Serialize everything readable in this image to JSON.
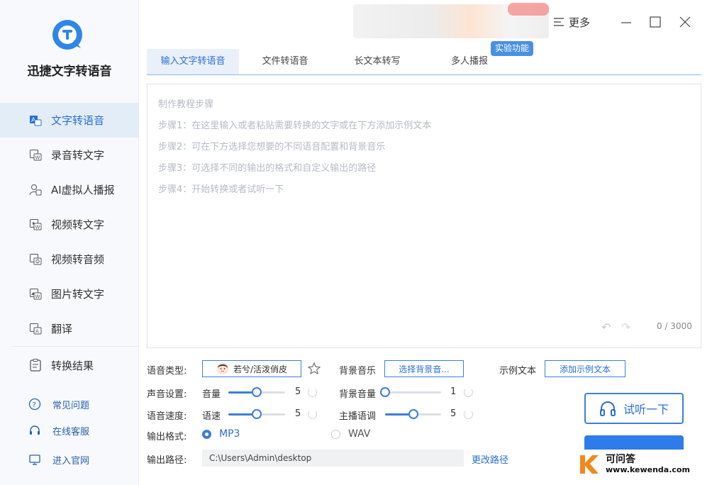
{
  "app": {
    "name": "迅捷文字转语音"
  },
  "header": {
    "more_label": "更多"
  },
  "sidebar": {
    "items": [
      {
        "label": "文字转语音",
        "icon": "text-to-speech-icon"
      },
      {
        "label": "录音转文字",
        "icon": "recording-to-text-icon"
      },
      {
        "label": "AI虚拟人播报",
        "icon": "virtual-person-icon"
      },
      {
        "label": "视频转文字",
        "icon": "video-to-text-icon"
      },
      {
        "label": "视频转音频",
        "icon": "video-to-audio-icon"
      },
      {
        "label": "图片转文字",
        "icon": "image-to-text-icon"
      },
      {
        "label": "翻译",
        "icon": "translate-icon"
      }
    ],
    "result_label": "转换结果",
    "faq_label": "常见问题",
    "service_label": "在线客服",
    "website_label": "进入官网"
  },
  "tabs": [
    "输入文字转语音",
    "文件转语音",
    "长文本转写",
    "多人播报"
  ],
  "experimental_badge": "实验功能",
  "editor": {
    "heading": "制作教程步骤",
    "steps": [
      "步骤1：在这里输入或者粘贴需要转换的文字或在下方添加示例文本",
      "步骤2：可在下方选择您想要的不同语音配置和背景音乐",
      "步骤3：可选择不同的输出的格式和自定义输出的路径",
      "步骤4：开始转换或者试听一下"
    ],
    "char_count": "0 / 3000"
  },
  "settings": {
    "voice_type_label": "语音类型:",
    "voice_name": "若兮/活泼俏皮",
    "bg_music_label": "背景音乐",
    "bg_music_button": "选择背景音...",
    "sample_text_label": "示例文本",
    "sample_text_button": "添加示例文本",
    "sound_settings_label": "声音设置:",
    "volume_label": "音量",
    "volume_value": "5",
    "volume_level": 0.5,
    "bg_volume_label": "背景音量",
    "bg_volume_value": "1",
    "bg_volume_level": 0.0,
    "speed_section_label": "语音速度:",
    "speed_label": "语速",
    "speed_value": "5",
    "speed_level": 0.5,
    "pitch_label": "主播语调",
    "pitch_value": "5",
    "pitch_level": 0.5,
    "format_label": "输出格式:",
    "format_options": [
      "MP3",
      "WAV"
    ],
    "format_selected": "MP3",
    "path_label": "输出路径:",
    "path_value": "C:\\Users\\Admin\\desktop",
    "change_path_label": "更改路径"
  },
  "actions": {
    "listen_label": "试听一下"
  },
  "watermark": {
    "title": "可问答",
    "url": "www.kewenda.com"
  },
  "colors": {
    "accent": "#2b6fd1",
    "sidebar_active_bg": "#e3edf8"
  }
}
